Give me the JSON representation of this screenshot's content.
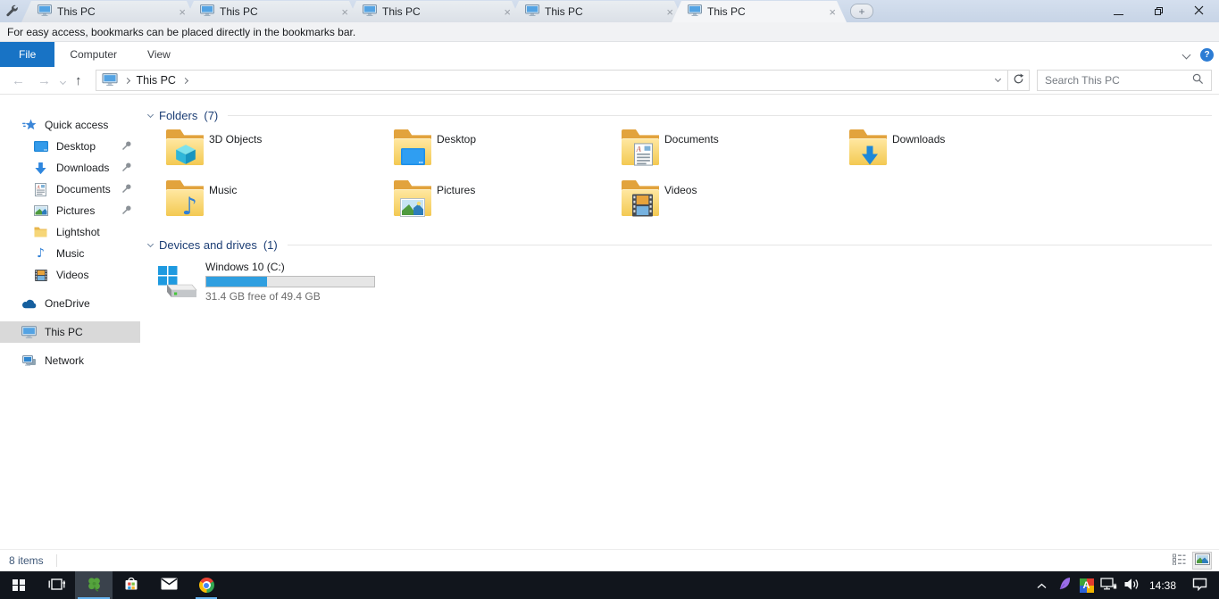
{
  "tabs": {
    "items": [
      {
        "label": "This PC",
        "active": false
      },
      {
        "label": "This PC",
        "active": false
      },
      {
        "label": "This PC",
        "active": false
      },
      {
        "label": "This PC",
        "active": false
      },
      {
        "label": "This PC",
        "active": true
      }
    ]
  },
  "bookmarks_bar": {
    "notice": "For easy access, bookmarks can be placed directly in the bookmarks bar."
  },
  "menu": {
    "items": [
      {
        "label": "File",
        "active": true
      },
      {
        "label": "Computer",
        "active": false
      },
      {
        "label": "View",
        "active": false
      }
    ]
  },
  "navigation": {
    "breadcrumb_root_label": "This PC",
    "search_placeholder": "Search This PC"
  },
  "sidebar": {
    "items": [
      {
        "label": "Quick access",
        "level": 0,
        "pinned": false
      },
      {
        "label": "Desktop",
        "level": 1,
        "pinned": true
      },
      {
        "label": "Downloads",
        "level": 1,
        "pinned": true
      },
      {
        "label": "Documents",
        "level": 1,
        "pinned": true
      },
      {
        "label": "Pictures",
        "level": 1,
        "pinned": true
      },
      {
        "label": "Lightshot",
        "level": 1,
        "pinned": false
      },
      {
        "label": "Music",
        "level": 1,
        "pinned": false
      },
      {
        "label": "Videos",
        "level": 1,
        "pinned": false
      },
      {
        "label": "OneDrive",
        "level": 0,
        "pinned": false
      },
      {
        "label": "This PC",
        "level": 0,
        "pinned": false,
        "selected": true
      },
      {
        "label": "Network",
        "level": 0,
        "pinned": false
      }
    ]
  },
  "main": {
    "folders_group": {
      "title": "Folders",
      "count_label": "(7)",
      "items": [
        {
          "label": "3D Objects"
        },
        {
          "label": "Desktop"
        },
        {
          "label": "Documents"
        },
        {
          "label": "Downloads"
        },
        {
          "label": "Music"
        },
        {
          "label": "Pictures"
        },
        {
          "label": "Videos"
        }
      ]
    },
    "devices_group": {
      "title": "Devices and drives",
      "count_label": "(1)",
      "drive": {
        "name": "Windows 10 (C:)",
        "free_text": "31.4 GB free of 49.4 GB",
        "used_percent": 36
      }
    }
  },
  "status_bar": {
    "items_count": "8 items"
  },
  "taskbar": {
    "time": "14:38"
  },
  "colors": {
    "accent_blue": "#1873c5",
    "titlebar_bg": "#cbd7e8",
    "folder_front_yellow": "#f3c952",
    "folder_back_yellow": "#e2a33d",
    "group_header_blue": "#1c3e75",
    "drive_bar_fill": "#2f9fe0",
    "selection_gray": "#d9d9d9",
    "taskbar_bg": "#11151c",
    "taskbar_underline": "#66b3ef"
  }
}
